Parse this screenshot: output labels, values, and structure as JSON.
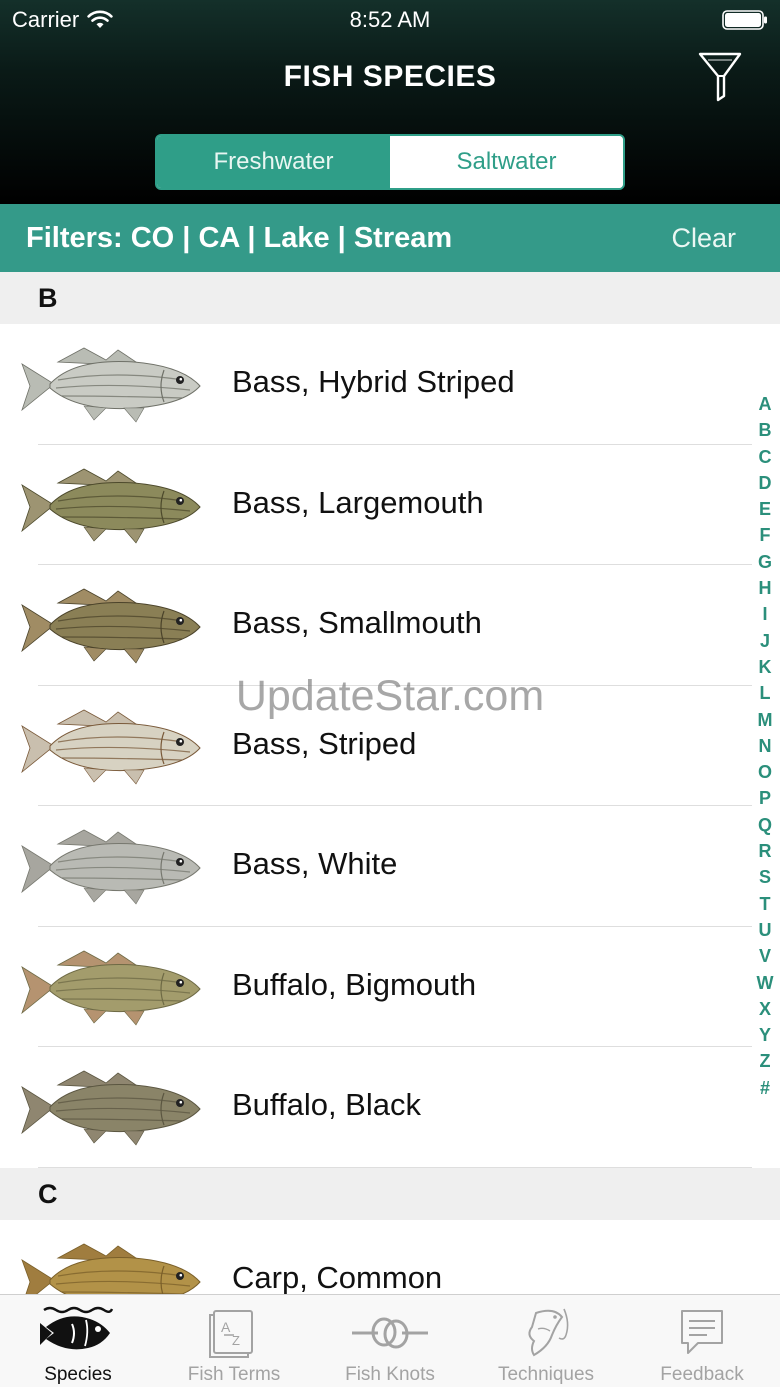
{
  "status": {
    "carrier": "Carrier",
    "time": "8:52 AM"
  },
  "nav": {
    "title": "FISH SPECIES",
    "filter_icon": "filter-funnel-icon"
  },
  "segments": [
    {
      "label": "Freshwater",
      "selected": true
    },
    {
      "label": "Saltwater",
      "selected": false
    }
  ],
  "filterbar": {
    "text": "Filters: CO | CA | Lake | Stream",
    "clear_label": "Clear"
  },
  "sections": [
    {
      "letter": "B",
      "items": [
        {
          "name": "Bass, Hybrid Striped",
          "icon": "fish-hybrid-striped-bass-icon",
          "colors": {
            "body": "#c9cbc4",
            "stripe": "#6f7168",
            "fin": "#b9bcb4"
          }
        },
        {
          "name": "Bass, Largemouth",
          "icon": "fish-largemouth-bass-icon",
          "colors": {
            "body": "#8c8a5c",
            "stripe": "#4d4a2c",
            "fin": "#9d9472"
          }
        },
        {
          "name": "Bass, Smallmouth",
          "icon": "fish-smallmouth-bass-icon",
          "colors": {
            "body": "#8a7f55",
            "stripe": "#4b432a",
            "fin": "#a08c64"
          }
        },
        {
          "name": "Bass, Striped",
          "icon": "fish-striped-bass-icon",
          "colors": {
            "body": "#d7d2c2",
            "stripe": "#7a5a3a",
            "fin": "#c9bfae"
          }
        },
        {
          "name": "Bass, White",
          "icon": "fish-white-bass-icon",
          "colors": {
            "body": "#b9bab4",
            "stripe": "#77786f",
            "fin": "#a7a69f"
          }
        },
        {
          "name": "Buffalo, Bigmouth",
          "icon": "fish-bigmouth-buffalo-icon",
          "colors": {
            "body": "#a39c6c",
            "stripe": "#6e6a45",
            "fin": "#b59370"
          }
        },
        {
          "name": "Buffalo, Black",
          "icon": "fish-black-buffalo-icon",
          "colors": {
            "body": "#8a8468",
            "stripe": "#5b5641",
            "fin": "#8f8670"
          }
        }
      ]
    },
    {
      "letter": "C",
      "items": [
        {
          "name": "Carp, Common",
          "icon": "fish-common-carp-icon",
          "colors": {
            "body": "#b29248",
            "stripe": "#7a5f29",
            "fin": "#a07d3f"
          }
        }
      ]
    }
  ],
  "index": [
    "A",
    "B",
    "C",
    "D",
    "E",
    "F",
    "G",
    "H",
    "I",
    "J",
    "K",
    "L",
    "M",
    "N",
    "O",
    "P",
    "Q",
    "R",
    "S",
    "T",
    "U",
    "V",
    "W",
    "X",
    "Y",
    "Z",
    "#"
  ],
  "watermark": "UpdateStar.com",
  "tabs": [
    {
      "label": "Species",
      "icon": "fish-waves-icon",
      "active": true
    },
    {
      "label": "Fish Terms",
      "icon": "dictionary-book-icon",
      "active": false
    },
    {
      "label": "Fish Knots",
      "icon": "knot-icon",
      "active": false
    },
    {
      "label": "Techniques",
      "icon": "fishing-technique-icon",
      "active": false
    },
    {
      "label": "Feedback",
      "icon": "speech-bubble-icon",
      "active": false
    }
  ],
  "colors": {
    "accent": "#2f9e88",
    "filterbar": "#349a89",
    "index": "#2b8f7b"
  }
}
